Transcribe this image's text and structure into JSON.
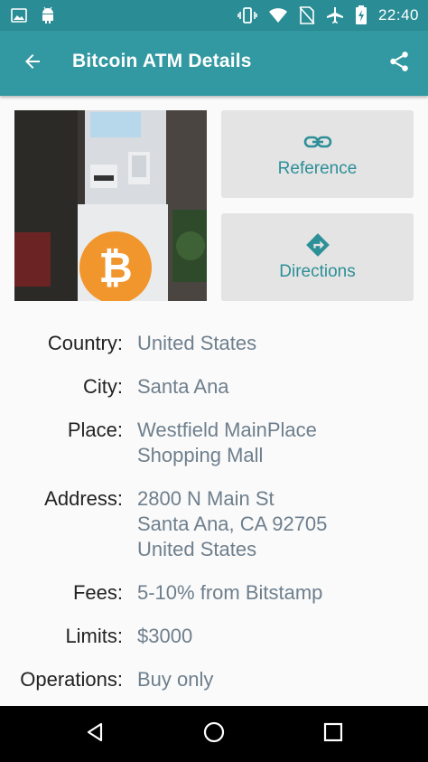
{
  "status_bar": {
    "time": "22:40",
    "icons": [
      "image-icon",
      "android-icon",
      "vibrate-icon",
      "wifi-icon",
      "no-sim-icon",
      "airplane-icon",
      "battery-charging-icon"
    ]
  },
  "app_bar": {
    "title": "Bitcoin ATM Details",
    "back_icon": "arrow-back-icon",
    "share_icon": "share-icon"
  },
  "photo": {
    "description_icon": "bitcoin-atm-photo"
  },
  "actions": {
    "reference_label": "Reference",
    "directions_label": "Directions"
  },
  "details": {
    "country": {
      "label": "Country:",
      "value": "United States"
    },
    "city": {
      "label": "City:",
      "value": "Santa Ana"
    },
    "place": {
      "label": "Place:",
      "value": "Westfield MainPlace\nShopping Mall"
    },
    "address": {
      "label": "Address:",
      "value": "2800 N Main St\nSanta Ana, CA 92705\nUnited States"
    },
    "fees": {
      "label": "Fees:",
      "value": "5-10% from Bitstamp"
    },
    "limits": {
      "label": "Limits:",
      "value": "$3000"
    },
    "operations": {
      "label": "Operations:",
      "value": "Buy only"
    }
  },
  "colors": {
    "status_bar": "#2a8d95",
    "app_bar": "#3298a1",
    "accent": "#2d8f98",
    "value_text": "#6e7f8d",
    "card_bg": "#e4e4e4"
  }
}
